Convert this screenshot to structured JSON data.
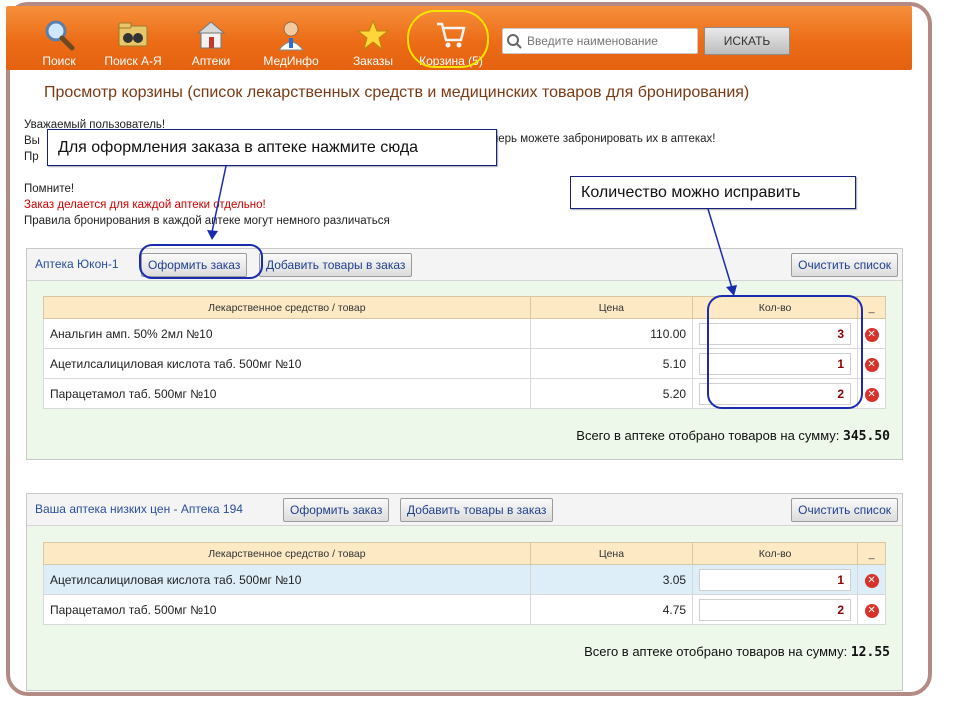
{
  "nav": {
    "items": [
      {
        "label": "Поиск"
      },
      {
        "label": "Поиск А-Я"
      },
      {
        "label": "Аптеки"
      },
      {
        "label": "МедИнфо"
      },
      {
        "label": "Заказы"
      },
      {
        "label": "Корзина (5)"
      }
    ]
  },
  "search": {
    "placeholder": "Введите наименование",
    "button": "ИСКАТЬ"
  },
  "page_title": "Просмотр корзины (список лекарственных средств и медицинских товаров для бронирования)",
  "notice": {
    "line1": "Уважаемый пользователь!",
    "line2_start": "Вы",
    "line2_end": "перь можете забронировать их в аптеках!",
    "line3_start": "Пр",
    "remember": "Помните!",
    "warning": "Заказ делается для каждой аптеки отдельно!",
    "rules": "Правила бронирования в каждой аптеке могут немного различаться"
  },
  "callouts": {
    "order": "Для оформления заказа в аптеке нажмите сюда",
    "qty": "Количество можно исправить"
  },
  "table_headers": {
    "name": "Лекарственное средство / товар",
    "price": "Цена",
    "qty": "Кол-во",
    "del": "_"
  },
  "pharmacies": [
    {
      "name": "Аптека Юкон-1",
      "order_button": "Оформить заказ",
      "add_button": "Добавить товары в заказ",
      "clear_button": "Очистить список",
      "rows": [
        {
          "name": "Анальгин амп. 50% 2мл №10",
          "price": "110.00",
          "qty": "3"
        },
        {
          "name": "Ацетилсалициловая кислота таб. 500мг №10",
          "price": "5.10",
          "qty": "1"
        },
        {
          "name": "Парацетамол таб. 500мг №10",
          "price": "5.20",
          "qty": "2"
        }
      ],
      "total_label": "Всего в аптеке отобрано товаров на сумму:",
      "total_value": "345.50"
    },
    {
      "name": "Ваша аптека низких цен - Аптека 194",
      "order_button": "Оформить заказ",
      "add_button": "Добавить товары в заказ",
      "clear_button": "Очистить список",
      "rows": [
        {
          "name": "Ацетилсалициловая кислота таб. 500мг №10",
          "price": "3.05",
          "qty": "1"
        },
        {
          "name": "Парацетамол таб. 500мг №10",
          "price": "4.75",
          "qty": "2"
        }
      ],
      "total_label": "Всего в аптеке отобрано товаров на сумму:",
      "total_value": "12.55"
    }
  ],
  "colors": {
    "topbar": "#ec6c17",
    "annotation": "#1a2bb0",
    "highlight": "#f6e400"
  }
}
